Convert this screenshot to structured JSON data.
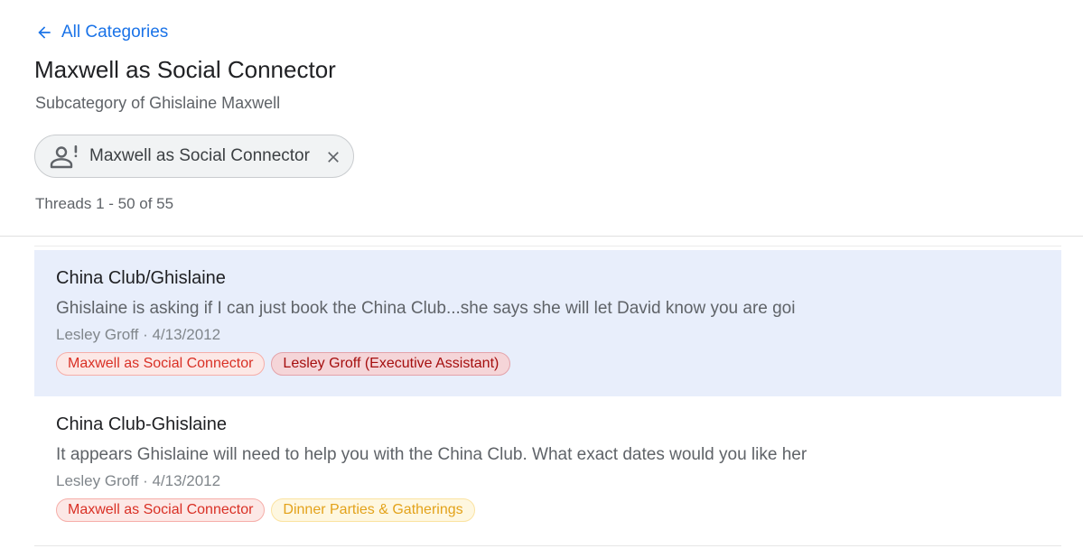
{
  "nav": {
    "back_label": "All Categories"
  },
  "header": {
    "title": "Maxwell as Social Connector",
    "subtitle": "Subcategory of Ghislaine Maxwell"
  },
  "filter_chip": {
    "label": "Maxwell as Social Connector",
    "icon": "person-alert-icon",
    "close_icon": "close-icon"
  },
  "thread_count": "Threads 1 - 50 of 55",
  "threads": [
    {
      "title": "China Club/Ghislaine",
      "snippet": "Ghislaine is asking if I can just book the China Club...she says she will let David know you are goi",
      "meta": "Lesley Groff · 4/13/2012",
      "selected": true,
      "tags": [
        {
          "label": "Maxwell as Social Connector",
          "color": "#d93025",
          "bg": "#fce8e6",
          "border": "#f6aea9"
        },
        {
          "label": "Lesley Groff (Executive Assistant)",
          "color": "#a50e0e",
          "bg": "#f5d5d8",
          "border": "#e3a3aa"
        }
      ]
    },
    {
      "title": "China Club-Ghislaine",
      "snippet": "It appears Ghislaine will need to help you with the China Club. What exact dates would you like her",
      "meta": "Lesley Groff · 4/13/2012",
      "selected": false,
      "tags": [
        {
          "label": "Maxwell as Social Connector",
          "color": "#d93025",
          "bg": "#fce8e6",
          "border": "#f6aea9"
        },
        {
          "label": "Dinner Parties & Gatherings",
          "color": "#e3a21a",
          "bg": "#fef7e0",
          "border": "#fbe3a1"
        }
      ]
    }
  ],
  "colors": {
    "accent": "#1a73e8",
    "selected_row": "#e8eefb",
    "chip_bg": "#f1f3f4"
  }
}
